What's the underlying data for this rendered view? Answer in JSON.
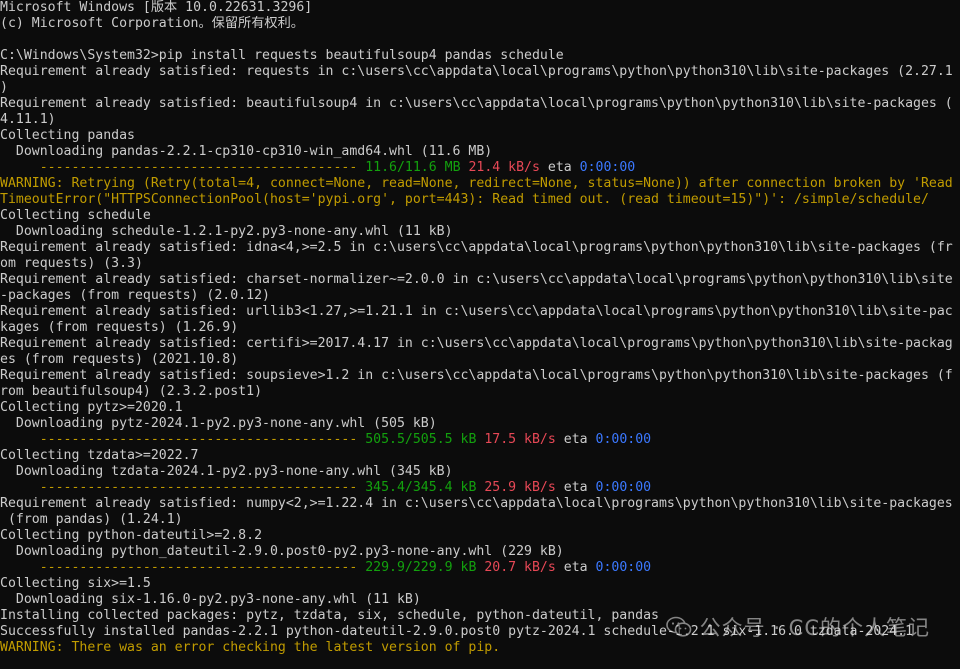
{
  "colors": {
    "background": "#0c0c0c",
    "text": "#cccccc",
    "progress_bar": "#c19c00",
    "progress_done": "#13a10e",
    "speed": "#e74856",
    "eta": "#3b78ff",
    "warning": "#c19c00"
  },
  "terminal": {
    "lines": [
      [
        {
          "t": "Microsoft Windows [版本 10.0.22631.3296]",
          "c": "white"
        }
      ],
      [
        {
          "t": "(c) Microsoft Corporation。保留所有权利。",
          "c": "white"
        }
      ],
      [
        {
          "t": "",
          "c": "white"
        }
      ],
      [
        {
          "t": "C:\\Windows\\System32>pip install requests beautifulsoup4 pandas schedule",
          "c": "white"
        }
      ],
      [
        {
          "t": "Requirement already satisfied: requests in c:\\users\\cc\\appdata\\local\\programs\\python\\python310\\lib\\site-packages (2.27.1",
          "c": "white"
        }
      ],
      [
        {
          "t": ")",
          "c": "white"
        }
      ],
      [
        {
          "t": "Requirement already satisfied: beautifulsoup4 in c:\\users\\cc\\appdata\\local\\programs\\python\\python310\\lib\\site-packages (",
          "c": "white"
        }
      ],
      [
        {
          "t": "4.11.1)",
          "c": "white"
        }
      ],
      [
        {
          "t": "Collecting pandas",
          "c": "white"
        }
      ],
      [
        {
          "t": "  Downloading pandas-2.2.1-cp310-cp310-win_amd64.whl (11.6 MB)",
          "c": "white"
        }
      ],
      [
        {
          "t": "     ---------------------------------------- ",
          "c": "bar"
        },
        {
          "t": "11.6/11.6 MB",
          "c": "green"
        },
        {
          "t": " ",
          "c": "white"
        },
        {
          "t": "21.4 kB/s",
          "c": "red"
        },
        {
          "t": " eta ",
          "c": "white"
        },
        {
          "t": "0:00:00",
          "c": "blue"
        }
      ],
      [
        {
          "t": "WARNING: Retrying (Retry(total=4, connect=None, read=None, redirect=None, status=None)) after connection broken by 'Read",
          "c": "yellow"
        }
      ],
      [
        {
          "t": "TimeoutError(\"HTTPSConnectionPool(host='pypi.org', port=443): Read timed out. (read timeout=15)\")': /simple/schedule/",
          "c": "yellow"
        }
      ],
      [
        {
          "t": "Collecting schedule",
          "c": "white"
        }
      ],
      [
        {
          "t": "  Downloading schedule-1.2.1-py2.py3-none-any.whl (11 kB)",
          "c": "white"
        }
      ],
      [
        {
          "t": "Requirement already satisfied: idna<4,>=2.5 in c:\\users\\cc\\appdata\\local\\programs\\python\\python310\\lib\\site-packages (fr",
          "c": "white"
        }
      ],
      [
        {
          "t": "om requests) (3.3)",
          "c": "white"
        }
      ],
      [
        {
          "t": "Requirement already satisfied: charset-normalizer~=2.0.0 in c:\\users\\cc\\appdata\\local\\programs\\python\\python310\\lib\\site",
          "c": "white"
        }
      ],
      [
        {
          "t": "-packages (from requests) (2.0.12)",
          "c": "white"
        }
      ],
      [
        {
          "t": "Requirement already satisfied: urllib3<1.27,>=1.21.1 in c:\\users\\cc\\appdata\\local\\programs\\python\\python310\\lib\\site-pac",
          "c": "white"
        }
      ],
      [
        {
          "t": "kages (from requests) (1.26.9)",
          "c": "white"
        }
      ],
      [
        {
          "t": "Requirement already satisfied: certifi>=2017.4.17 in c:\\users\\cc\\appdata\\local\\programs\\python\\python310\\lib\\site-packag",
          "c": "white"
        }
      ],
      [
        {
          "t": "es (from requests) (2021.10.8)",
          "c": "white"
        }
      ],
      [
        {
          "t": "Requirement already satisfied: soupsieve>1.2 in c:\\users\\cc\\appdata\\local\\programs\\python\\python310\\lib\\site-packages (f",
          "c": "white"
        }
      ],
      [
        {
          "t": "rom beautifulsoup4) (2.3.2.post1)",
          "c": "white"
        }
      ],
      [
        {
          "t": "Collecting pytz>=2020.1",
          "c": "white"
        }
      ],
      [
        {
          "t": "  Downloading pytz-2024.1-py2.py3-none-any.whl (505 kB)",
          "c": "white"
        }
      ],
      [
        {
          "t": "     ---------------------------------------- ",
          "c": "bar"
        },
        {
          "t": "505.5/505.5 kB",
          "c": "green"
        },
        {
          "t": " ",
          "c": "white"
        },
        {
          "t": "17.5 kB/s",
          "c": "red"
        },
        {
          "t": " eta ",
          "c": "white"
        },
        {
          "t": "0:00:00",
          "c": "blue"
        }
      ],
      [
        {
          "t": "Collecting tzdata>=2022.7",
          "c": "white"
        }
      ],
      [
        {
          "t": "  Downloading tzdata-2024.1-py2.py3-none-any.whl (345 kB)",
          "c": "white"
        }
      ],
      [
        {
          "t": "     ---------------------------------------- ",
          "c": "bar"
        },
        {
          "t": "345.4/345.4 kB",
          "c": "green"
        },
        {
          "t": " ",
          "c": "white"
        },
        {
          "t": "25.9 kB/s",
          "c": "red"
        },
        {
          "t": " eta ",
          "c": "white"
        },
        {
          "t": "0:00:00",
          "c": "blue"
        }
      ],
      [
        {
          "t": "Requirement already satisfied: numpy<2,>=1.22.4 in c:\\users\\cc\\appdata\\local\\programs\\python\\python310\\lib\\site-packages",
          "c": "white"
        }
      ],
      [
        {
          "t": " (from pandas) (1.24.1)",
          "c": "white"
        }
      ],
      [
        {
          "t": "Collecting python-dateutil>=2.8.2",
          "c": "white"
        }
      ],
      [
        {
          "t": "  Downloading python_dateutil-2.9.0.post0-py2.py3-none-any.whl (229 kB)",
          "c": "white"
        }
      ],
      [
        {
          "t": "     ---------------------------------------- ",
          "c": "bar"
        },
        {
          "t": "229.9/229.9 kB",
          "c": "green"
        },
        {
          "t": " ",
          "c": "white"
        },
        {
          "t": "20.7 kB/s",
          "c": "red"
        },
        {
          "t": " eta ",
          "c": "white"
        },
        {
          "t": "0:00:00",
          "c": "blue"
        }
      ],
      [
        {
          "t": "Collecting six>=1.5",
          "c": "white"
        }
      ],
      [
        {
          "t": "  Downloading six-1.16.0-py2.py3-none-any.whl (11 kB)",
          "c": "white"
        }
      ],
      [
        {
          "t": "Installing collected packages: pytz, tzdata, six, schedule, python-dateutil, pandas",
          "c": "white"
        }
      ],
      [
        {
          "t": "Successfully installed pandas-2.2.1 python-dateutil-2.9.0.post0 pytz-2024.1 schedule-1.2.1 six-1.16.0 tzdata-2024.1",
          "c": "white"
        }
      ],
      [
        {
          "t": "WARNING: There was an error checking the latest version of pip.",
          "c": "yellow"
        }
      ]
    ]
  },
  "watermark": {
    "text": "公众号 · CC的个人笔记",
    "icon": "wechat-icon"
  }
}
